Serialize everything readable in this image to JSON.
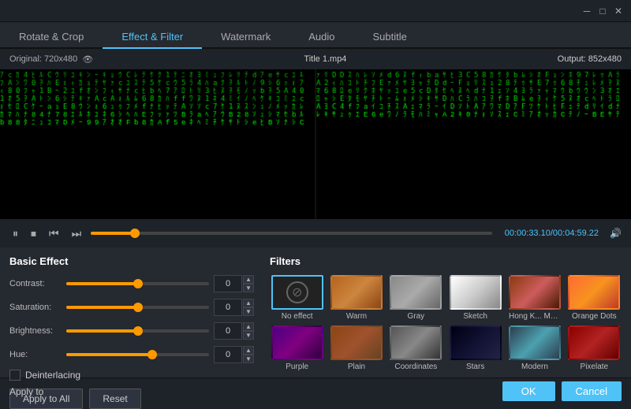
{
  "window": {
    "min_btn": "─",
    "max_btn": "□",
    "close_btn": "✕"
  },
  "tabs": {
    "items": [
      {
        "label": "Rotate & Crop",
        "active": false
      },
      {
        "label": "Effect & Filter",
        "active": true
      },
      {
        "label": "Watermark",
        "active": false
      },
      {
        "label": "Audio",
        "active": false
      },
      {
        "label": "Subtitle",
        "active": false
      }
    ]
  },
  "info_bar": {
    "original": "Original: 720x480",
    "title": "Title 1.mp4",
    "output": "Output: 852x480"
  },
  "playback": {
    "time_current": "00:00:33.10",
    "time_total": "00:04:59.22",
    "progress_pct": 11
  },
  "basic_effect": {
    "title": "Basic Effect",
    "contrast_label": "Contrast:",
    "contrast_value": "0",
    "saturation_label": "Saturation:",
    "saturation_value": "0",
    "brightness_label": "Brightness:",
    "brightness_value": "0",
    "hue_label": "Hue:",
    "hue_value": "0",
    "deinterlacing_label": "Deinterlacing",
    "apply_all_label": "Apply to All",
    "reset_label": "Reset"
  },
  "filters": {
    "title": "Filters",
    "items": [
      {
        "label": "No effect",
        "type": "no-effect",
        "selected": true
      },
      {
        "label": "Warm",
        "type": "warm",
        "selected": false
      },
      {
        "label": "Gray",
        "type": "gray",
        "selected": false
      },
      {
        "label": "Sketch",
        "type": "sketch",
        "selected": false
      },
      {
        "label": "Hong K... Movie",
        "type": "hongk",
        "selected": false
      },
      {
        "label": "Orange Dots",
        "type": "orange",
        "selected": false
      },
      {
        "label": "Purple",
        "type": "purple",
        "selected": false
      },
      {
        "label": "Plain",
        "type": "plain",
        "selected": false
      },
      {
        "label": "Coordinates",
        "type": "coords",
        "selected": false
      },
      {
        "label": "Stars",
        "type": "stars",
        "selected": false
      },
      {
        "label": "Modern",
        "type": "modern",
        "selected": false
      },
      {
        "label": "Pixelate",
        "type": "pixelate",
        "selected": false
      }
    ]
  },
  "bottom": {
    "apply_to_label": "Apply to",
    "ok_label": "OK",
    "cancel_label": "Cancel"
  }
}
